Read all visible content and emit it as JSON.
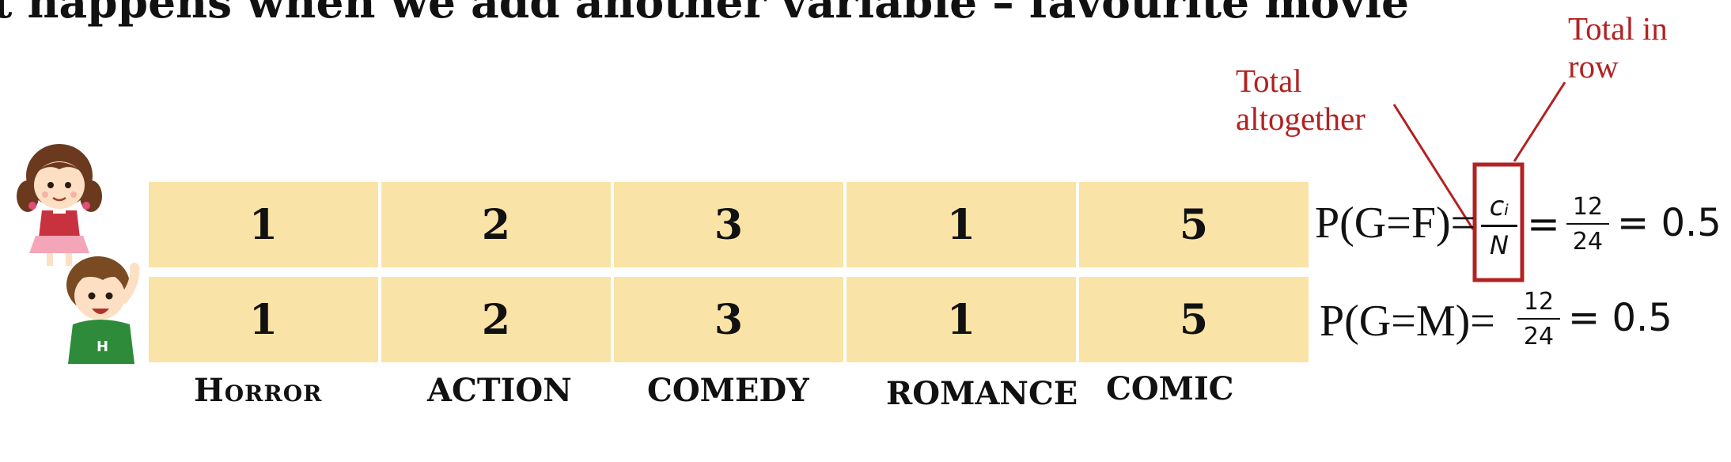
{
  "title": "t happens when we add another variable – favourite movie",
  "rows": [
    {
      "id": "girl",
      "values": [
        "1",
        "2",
        "3",
        "1",
        "5"
      ]
    },
    {
      "id": "boy",
      "values": [
        "1",
        "2",
        "3",
        "1",
        "5"
      ]
    }
  ],
  "genres": [
    "Horror",
    "ACTION",
    "COMEDY",
    "ROMANCE",
    "COMIC"
  ],
  "annotations": {
    "total_altogether_line1": "Total",
    "total_altogether_line2": "altogether",
    "total_in_row_line1": "Total in",
    "total_in_row_line2": "row"
  },
  "formulas": {
    "female_lhs": "P(G=F)=",
    "female_num_symbol": "cᵢ",
    "female_den_symbol": "N",
    "female_num": "12",
    "female_den": "24",
    "female_result": "= 0.5",
    "male_lhs": "P(G=M)=",
    "male_num": "12",
    "male_den": "24",
    "male_result": "= 0.5"
  },
  "colors": {
    "cell_fill": "#fae3a6",
    "annotation": "#b22222"
  },
  "icons": [
    "girl-avatar-icon",
    "boy-avatar-icon"
  ]
}
